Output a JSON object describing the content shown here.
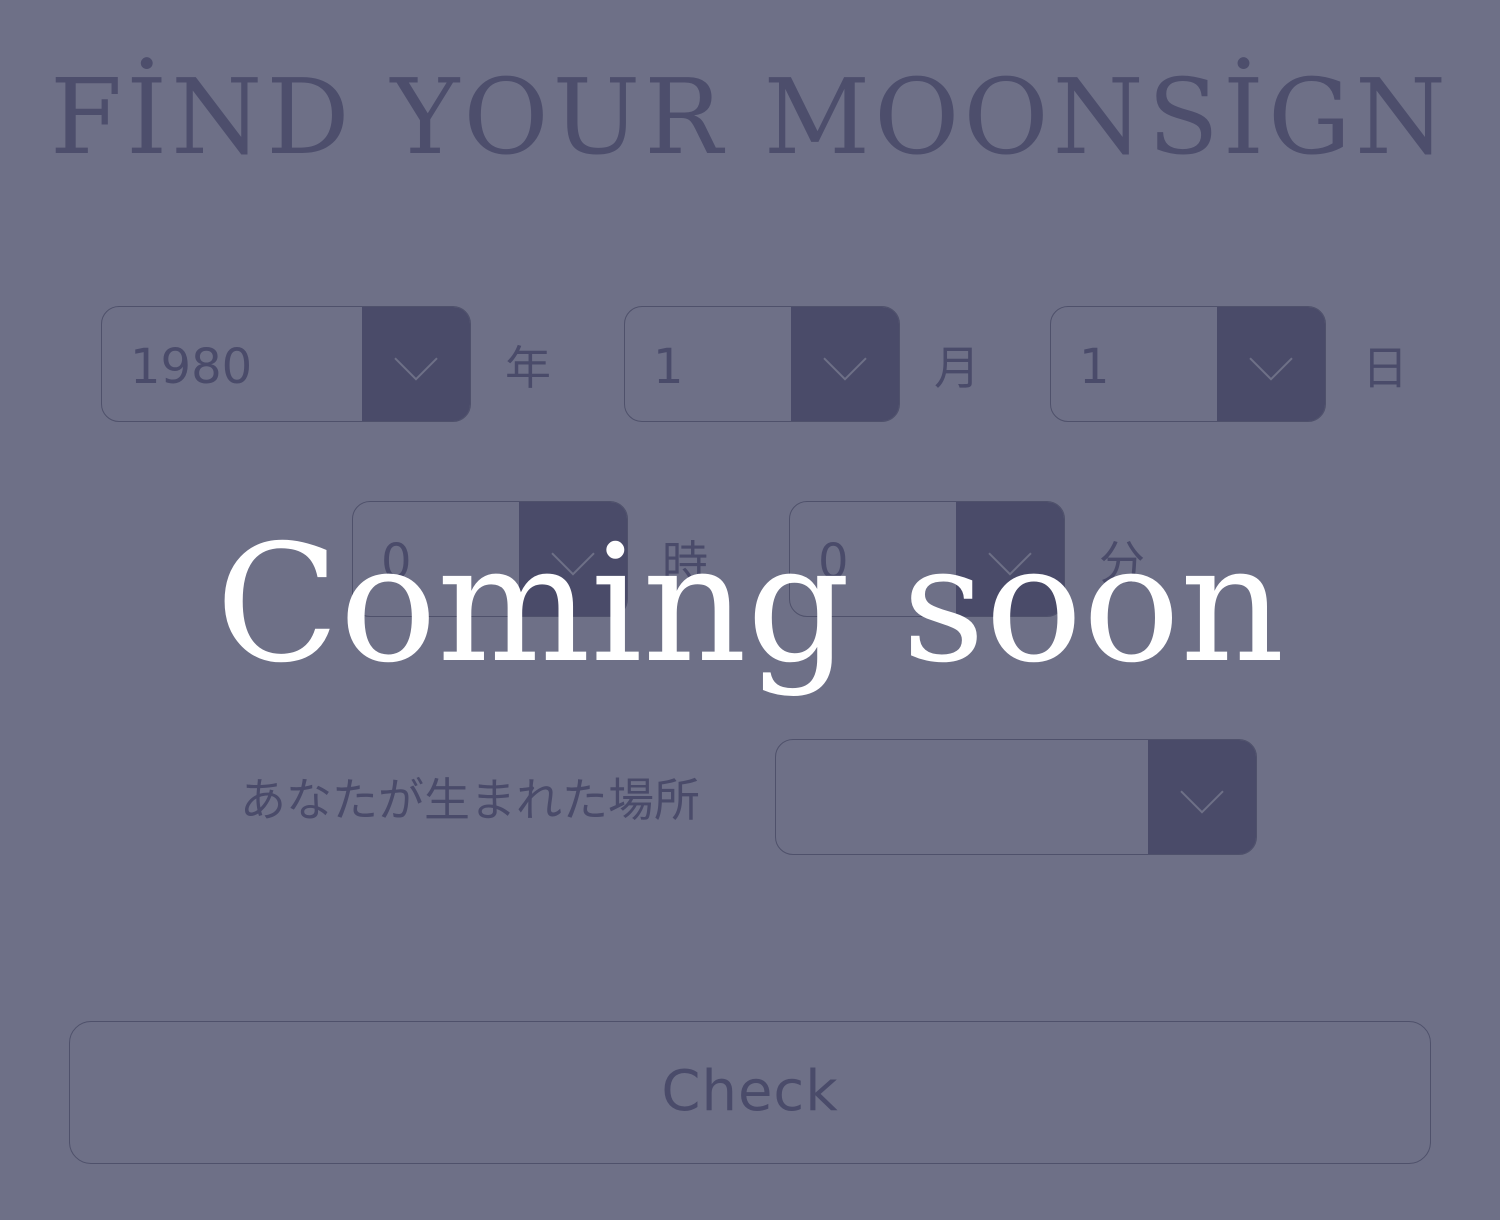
{
  "page": {
    "title": "FİND YOUR MOONSİGN"
  },
  "birthdate": {
    "year": {
      "value": "1980",
      "unit": "年"
    },
    "month": {
      "value": "1",
      "unit": "月"
    },
    "day": {
      "value": "1",
      "unit": "日"
    }
  },
  "birthtime": {
    "hour": {
      "value": "0",
      "unit": "時"
    },
    "minute": {
      "value": "0",
      "unit": "分"
    }
  },
  "birthplace": {
    "label": "あなたが生まれた場所",
    "value": ""
  },
  "actions": {
    "check_label": "Check"
  },
  "overlay": {
    "message": "Coming soon"
  },
  "colors": {
    "background": "#6e7087",
    "accent": "#4a4b69",
    "overlay_text": "#ffffff"
  },
  "icons": {
    "dropdown": "chevron-down-icon"
  }
}
